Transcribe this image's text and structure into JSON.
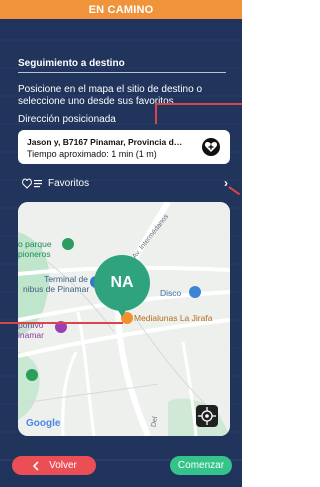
{
  "header": {
    "title": "EN CAMINO"
  },
  "section": {
    "title": "Seguimiento a destino",
    "description": "Posicione en el mapa el sitio de destino o seleccione uno desde sus favoritos",
    "position_label": "Dirección posicionada"
  },
  "address": {
    "line1": "Jason y, B7167 Pinamar, Provincia de ...",
    "line2": "Tiempo aproximado: 1 min (1 m)",
    "add_favorite_icon": "heart-plus-icon"
  },
  "favorites": {
    "label": "Favoritos",
    "icon": "heart-list-icon",
    "chevron_icon": "chevron-right-icon"
  },
  "map": {
    "marker_label": "NA",
    "places": {
      "parque": "o parque\npioneros",
      "terminal": "Terminal de\nnibus de Pinamar",
      "disco": "Disco",
      "medialunas": "Medialunas La Jirafa",
      "portivo": "portivo\ninamar",
      "street": "Av. Intermédanos",
      "street2": "Del"
    },
    "google": "Google",
    "locate_icon": "crosshair-icon"
  },
  "footer": {
    "back_label": "Volver",
    "next_label": "Comenzar"
  },
  "colors": {
    "header": "#f0933b",
    "back": "#eb4f55",
    "next": "#34c489",
    "marker": "#2fa37e",
    "background": "#20335c"
  }
}
